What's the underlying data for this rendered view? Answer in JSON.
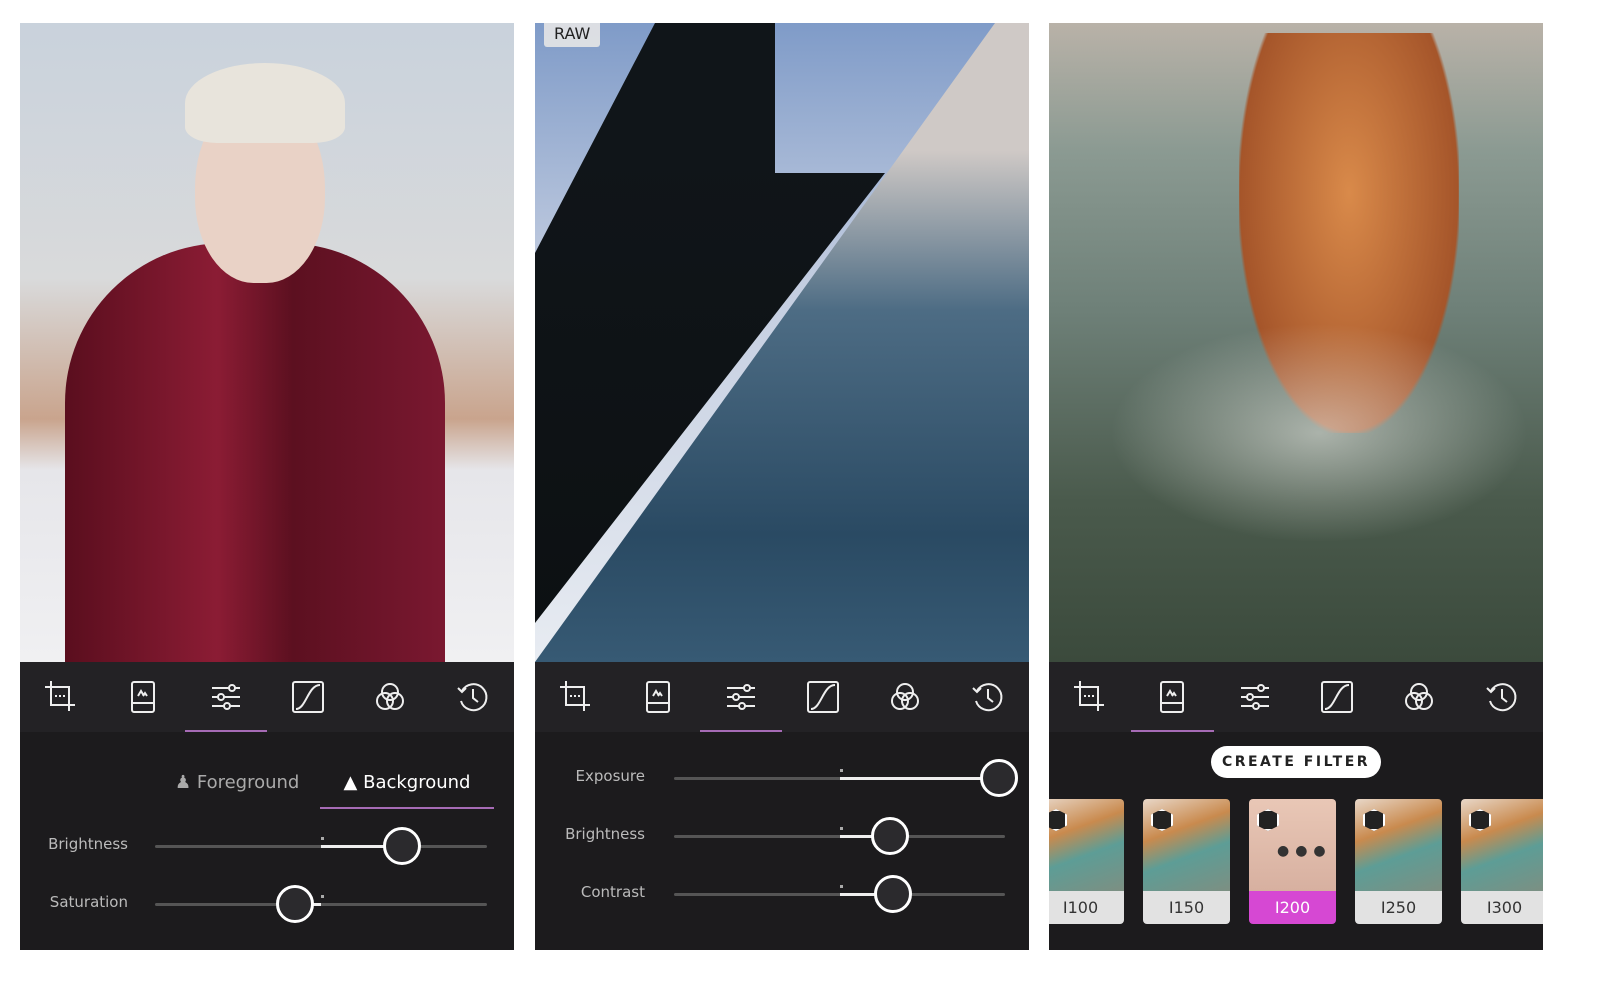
{
  "accent_color": "#a66bb5",
  "filter_highlight_color": "#d648d3",
  "toolbar_icons": [
    "crop-icon",
    "filter-icon",
    "adjust-sliders-icon",
    "curves-icon",
    "color-mix-icon",
    "history-icon"
  ],
  "panels": [
    {
      "active_tool": 2,
      "segments": [
        {
          "icon": "person-icon",
          "label": "Foreground",
          "active": false
        },
        {
          "icon": "mountain-icon",
          "label": "Background",
          "active": true
        }
      ],
      "sliders": [
        {
          "label": "Brightness",
          "value": 0.74
        },
        {
          "label": "Saturation",
          "value": 0.42
        }
      ]
    },
    {
      "badge": "RAW",
      "active_tool": 2,
      "sliders": [
        {
          "label": "Exposure",
          "value": 0.98
        },
        {
          "label": "Brightness",
          "value": 0.65
        },
        {
          "label": "Contrast",
          "value": 0.66
        }
      ]
    },
    {
      "active_tool": 1,
      "create_filter_label": "CREATE FILTER",
      "filters": [
        {
          "name": "I100",
          "selected": false
        },
        {
          "name": "I150",
          "selected": false
        },
        {
          "name": "I200",
          "selected": true
        },
        {
          "name": "I250",
          "selected": false
        },
        {
          "name": "I300",
          "selected": false
        }
      ]
    }
  ]
}
